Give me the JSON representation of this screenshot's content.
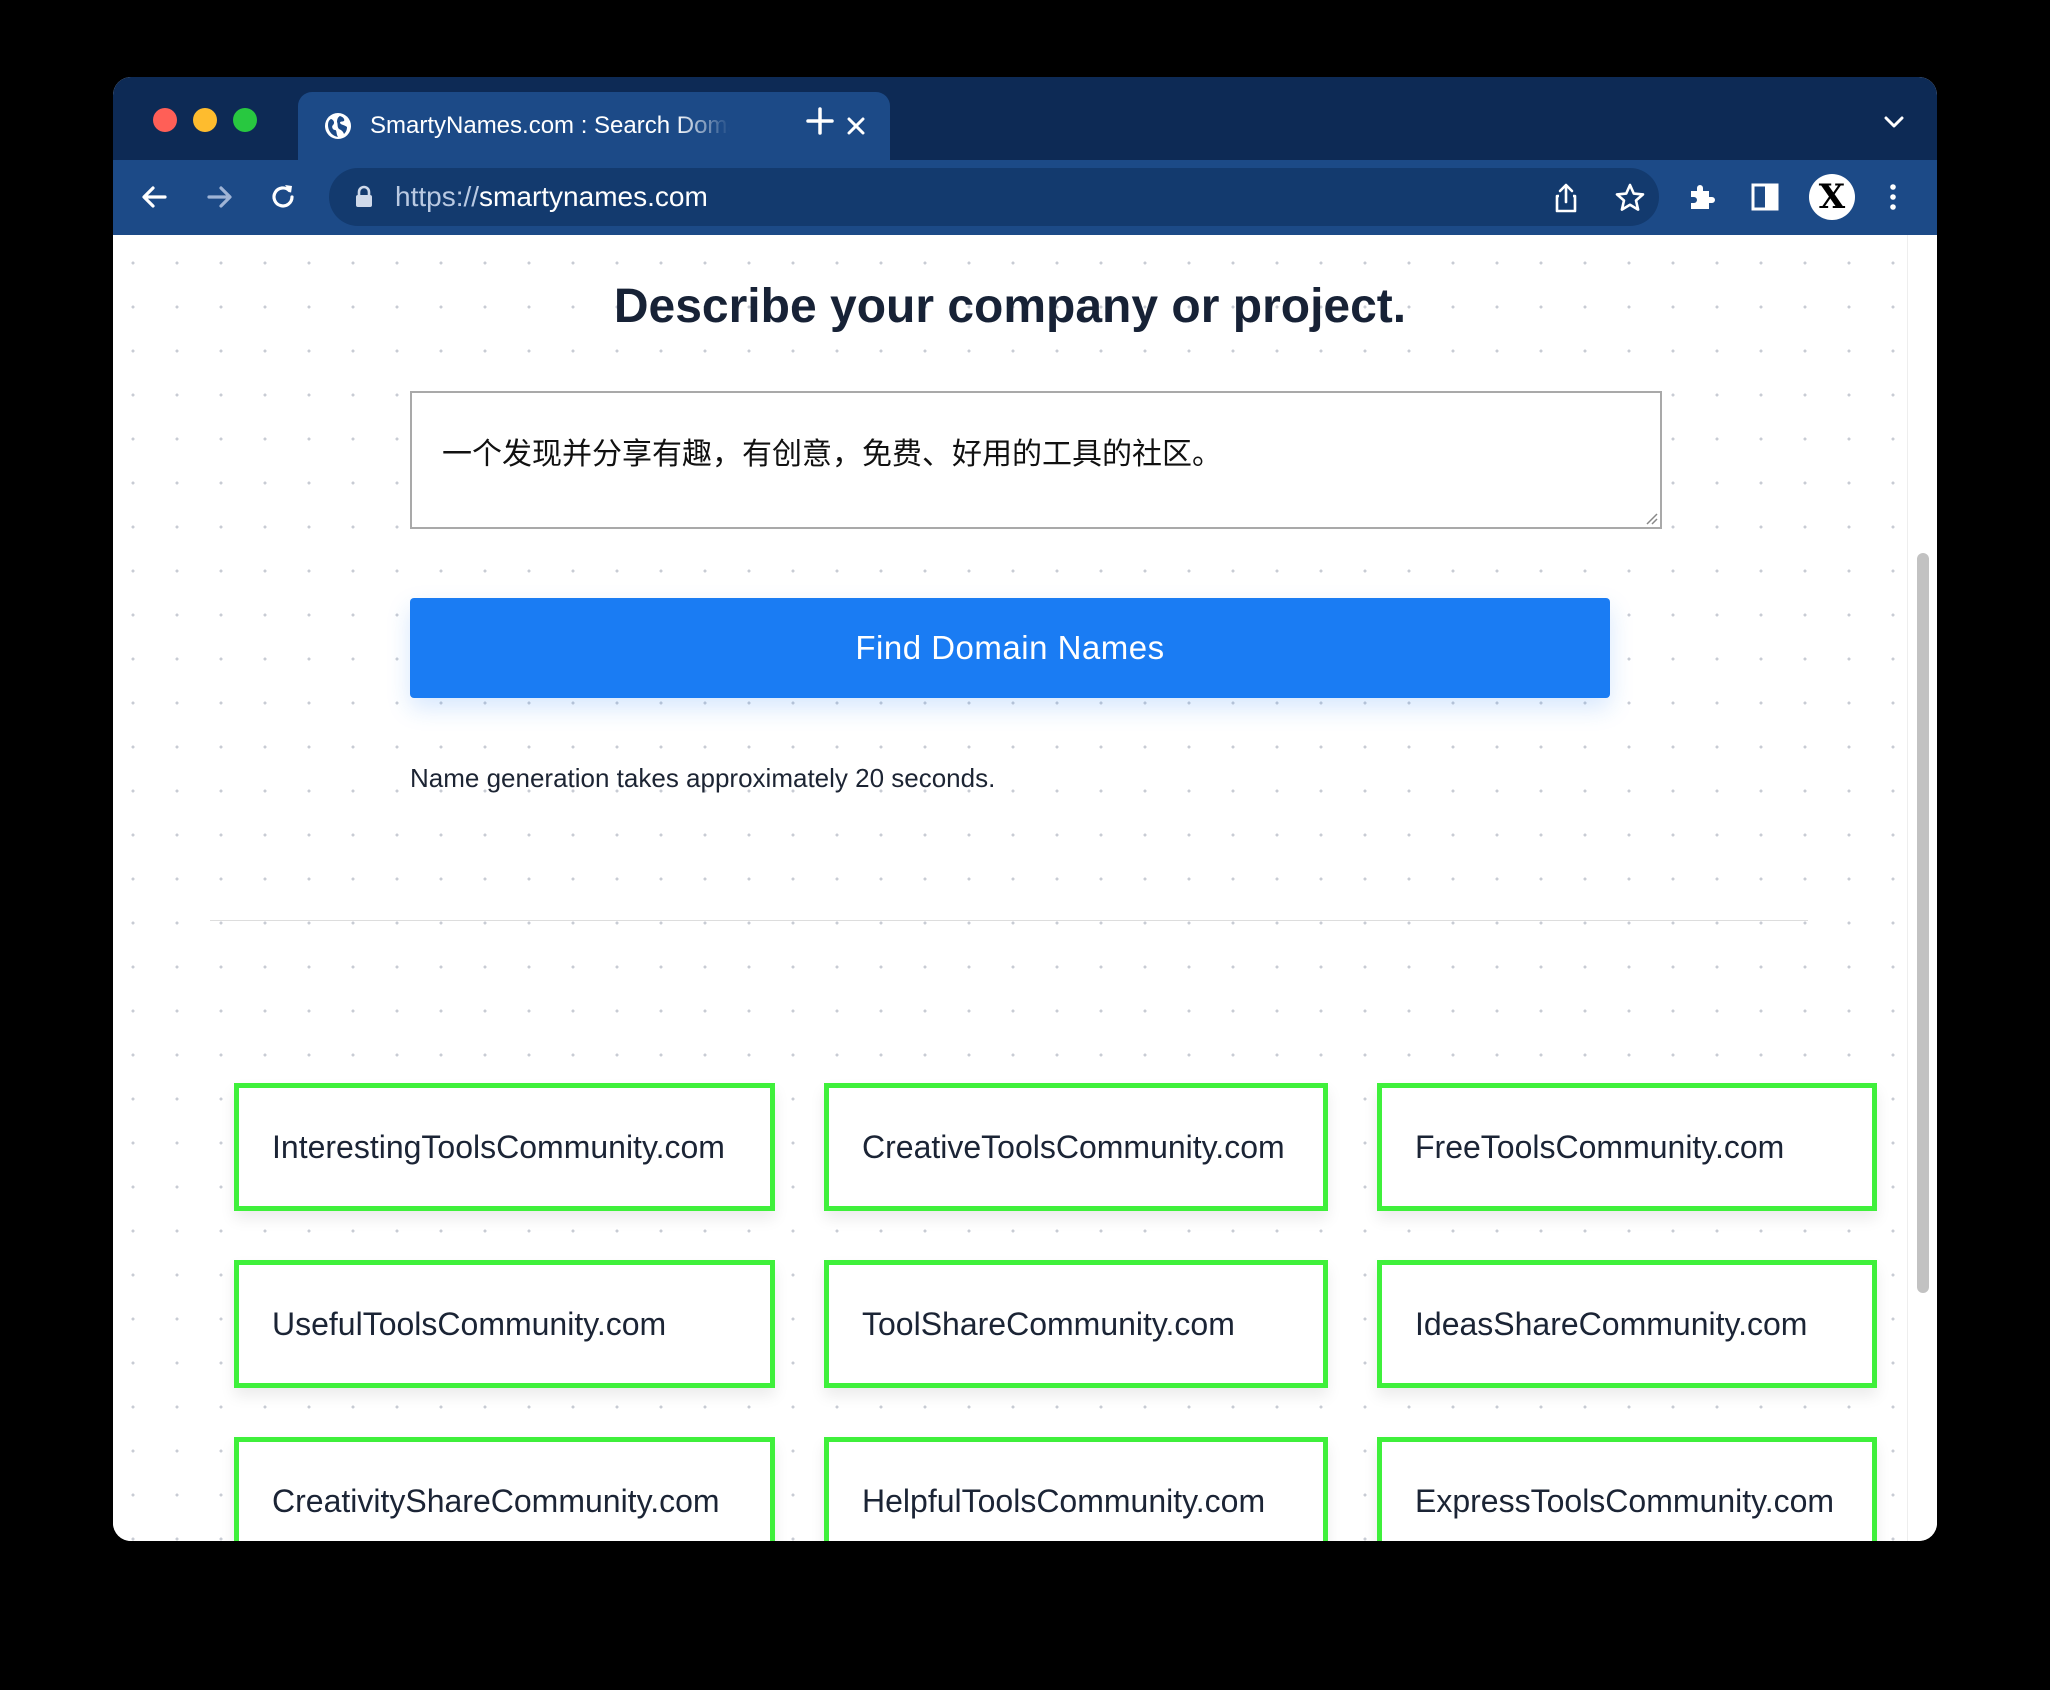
{
  "browser": {
    "tab": {
      "title": "SmartyNames.com : Search Domain Names",
      "favicon": "globe-icon"
    },
    "url": {
      "scheme": "https://",
      "host": "smartynames.com"
    },
    "profile_initial": "X",
    "colors": {
      "frame": "#0d2a55",
      "toolbar": "#1c4a87",
      "traffic_red": "#ff5f57",
      "traffic_yellow": "#febc2e",
      "traffic_green": "#28c840"
    }
  },
  "page": {
    "heading": "Describe your company or project.",
    "description_value": "一个发现并分享有趣，有创意，免费、好用的工具的社区。",
    "find_button_label": "Find Domain Names",
    "note": "Name generation takes approximately 20 seconds.",
    "colors": {
      "button": "#1a7cf3",
      "card_border": "#3ff03b"
    },
    "results": [
      "InterestingToolsCommunity.com",
      "CreativeToolsCommunity.com",
      "FreeToolsCommunity.com",
      "UsefulToolsCommunity.com",
      "ToolShareCommunity.com",
      "IdeasShareCommunity.com",
      "CreativityShareCommunity.com",
      "HelpfulToolsCommunity.com",
      "ExpressToolsCommunity.com"
    ]
  }
}
